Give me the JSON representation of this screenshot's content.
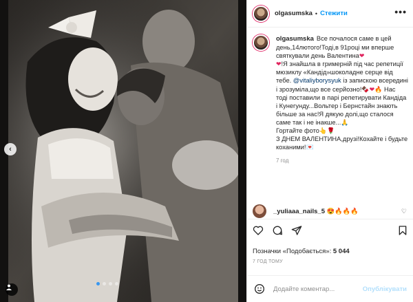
{
  "post": {
    "username": "olgasumska",
    "follow_label": "Стежити",
    "separator": "•",
    "more_label": "•••",
    "caption": {
      "username": "olgasumska",
      "p1": "Все почалося саме в цей день,14лютого!Тоді,в 91році ми вперше святкували день Валентина",
      "p2": "!Я знайшла в гримерній під час репетиції мюзиклу «Кандід»шоколадне серце від тебе. ",
      "mention": "@vitaliyborysyuk",
      "p3": " із запискою всередині і зрозуміла,що все серйозно!",
      "p4": " Нас тоді поставили в парі репетирувати Кандіда і Кунегунду...Вольтер і Бернстайн знають більше за нас!Я дякую долі,що сталося саме так і не інакше...",
      "p5": "Гортайте фото",
      "p6": "З ДНЕМ ВАЛЕНТИНА,друзі!Кохайте і будьте коханими!",
      "time": "7 год"
    },
    "comment": {
      "username": "_yuliaaa_nails_5",
      "text": "😍🔥🔥🔥"
    },
    "likes_prefix": "Позначки «Подобається»: ",
    "likes_count": "5 044",
    "time_ago": "7 ГОД ТОМУ",
    "comment_placeholder": "Додайте коментар...",
    "publish_label": "Опублікувати"
  },
  "colors": {
    "accent": "#0095f6",
    "publish_disabled": "#b2dffc",
    "mention": "#00376b"
  },
  "icons": [
    "heart-icon",
    "comment-icon",
    "share-icon",
    "bookmark-icon",
    "emoji-icon",
    "tag-icon",
    "next-arrow-icon"
  ]
}
